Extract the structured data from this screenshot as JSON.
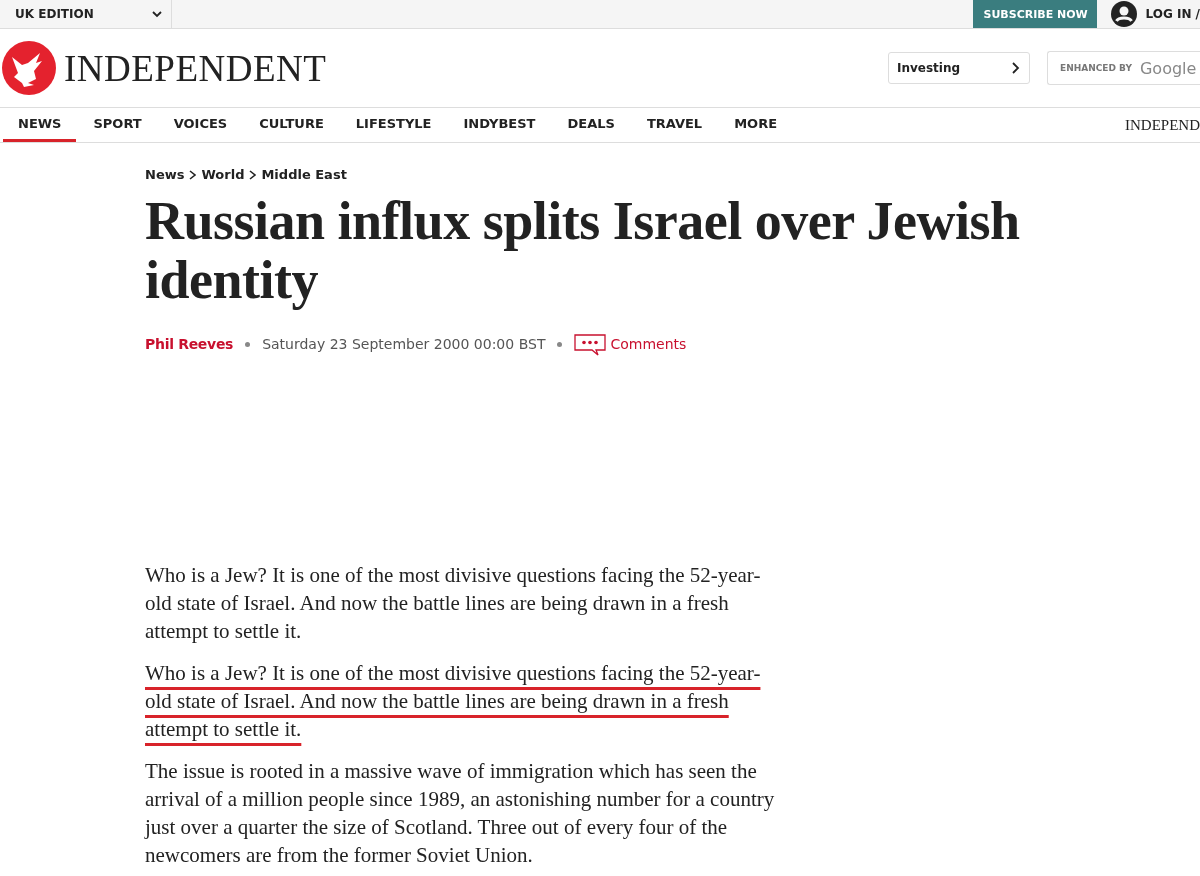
{
  "top_bar": {
    "edition": "UK EDITION",
    "subscribe": "SUBSCRIBE NOW",
    "login": "LOG IN /"
  },
  "masthead": {
    "logo": "INDEPENDENT",
    "topic_link": "Investing",
    "search_label": "ENHANCED BY",
    "search_brand": "Google"
  },
  "nav": {
    "items": [
      {
        "label": "NEWS",
        "selected": true
      },
      {
        "label": "SPORT",
        "selected": false
      },
      {
        "label": "VOICES",
        "selected": false
      },
      {
        "label": "CULTURE",
        "selected": false
      },
      {
        "label": "LIFESTYLE",
        "selected": false
      },
      {
        "label": "INDYBEST",
        "selected": false
      },
      {
        "label": "DEALS",
        "selected": false
      },
      {
        "label": "TRAVEL",
        "selected": false
      },
      {
        "label": "MORE",
        "selected": false
      }
    ],
    "mini_logo": "INDEPEND"
  },
  "breadcrumb": [
    "News",
    "World",
    "Middle East"
  ],
  "headline": "Russian influx splits Israel over Jewish identity",
  "byline": {
    "author": "Phil Reeves",
    "date": "Saturday 23 September 2000 00:00 BST",
    "comments": "Comments"
  },
  "paragraphs": [
    {
      "text": "Who is a Jew? It is one of the most divisive questions facing the 52-year-old state of Israel. And now the battle lines are being drawn in a fresh attempt to settle it.",
      "underlined": false
    },
    {
      "text": "Who is a Jew? It is one of the most divisive questions facing the 52-year-old state of Israel. And now the battle lines are being drawn in a fresh attempt to settle it.",
      "underlined": true
    },
    {
      "text": "The issue is rooted in a massive wave of immigration which has seen the arrival of a million people since 1989, an astonishing number for a country just over a quarter the size of Scotland. Three out of every four of the newcomers are from the former Soviet Union.",
      "underlined": false
    }
  ]
}
